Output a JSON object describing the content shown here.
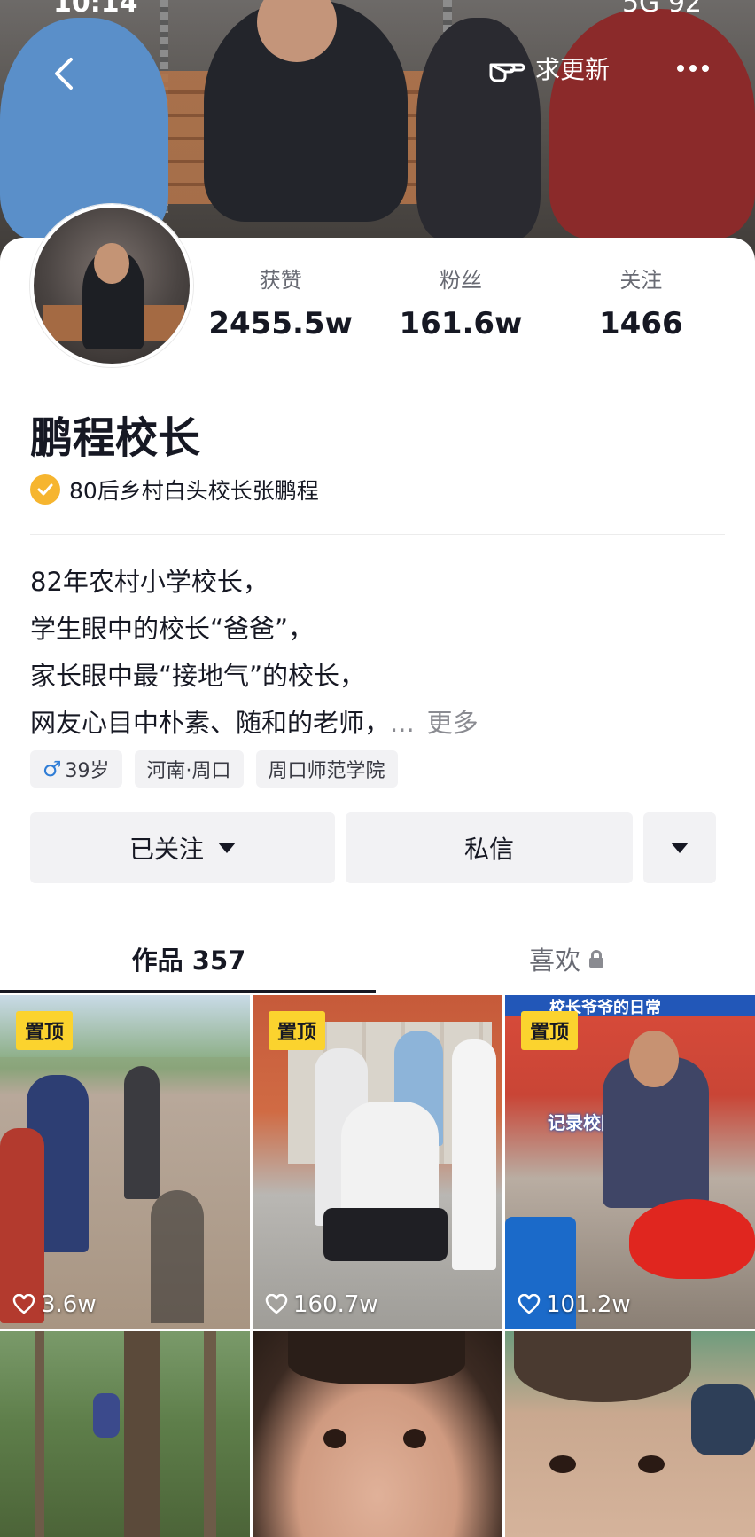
{
  "header": {
    "status_time": "10:14",
    "status_right": "5G 92",
    "request_update_label": "求更新"
  },
  "profile": {
    "name": "鹏程校长",
    "verified_title": "80后乡村白头校长张鹏程",
    "stats": [
      {
        "label": "获赞",
        "value": "2455.5w"
      },
      {
        "label": "粉丝",
        "value": "161.6w"
      },
      {
        "label": "关注",
        "value": "1466"
      }
    ],
    "bio_lines": [
      "82年农村小学校长，",
      "学生眼中的校长“爸爸”，",
      "家长眼中最“接地气”的校长，",
      "网友心目中朴素、随和的老师，"
    ],
    "bio_ellipsis": "...",
    "bio_more": "更多",
    "tags": {
      "age": "39岁",
      "location": "河南·周口",
      "school": "周口师范学院"
    }
  },
  "actions": {
    "follow_label": "已关注",
    "message_label": "私信"
  },
  "tabs": {
    "works_label": "作品 357",
    "likes_label": "喜欢"
  },
  "videos": [
    {
      "pinned_label": "置顶",
      "likes": "3.6w"
    },
    {
      "pinned_label": "置顶",
      "likes": "160.7w"
    },
    {
      "pinned_label": "置顶",
      "likes": "101.2w",
      "caption_top": "校长爷爷的日常",
      "caption_mid": "记录校园故事"
    },
    {},
    {},
    {}
  ],
  "colors": {
    "pin_badge": "#fbd32e",
    "verify_badge": "#f6b52f",
    "male_symbol": "#2f7dd6"
  }
}
